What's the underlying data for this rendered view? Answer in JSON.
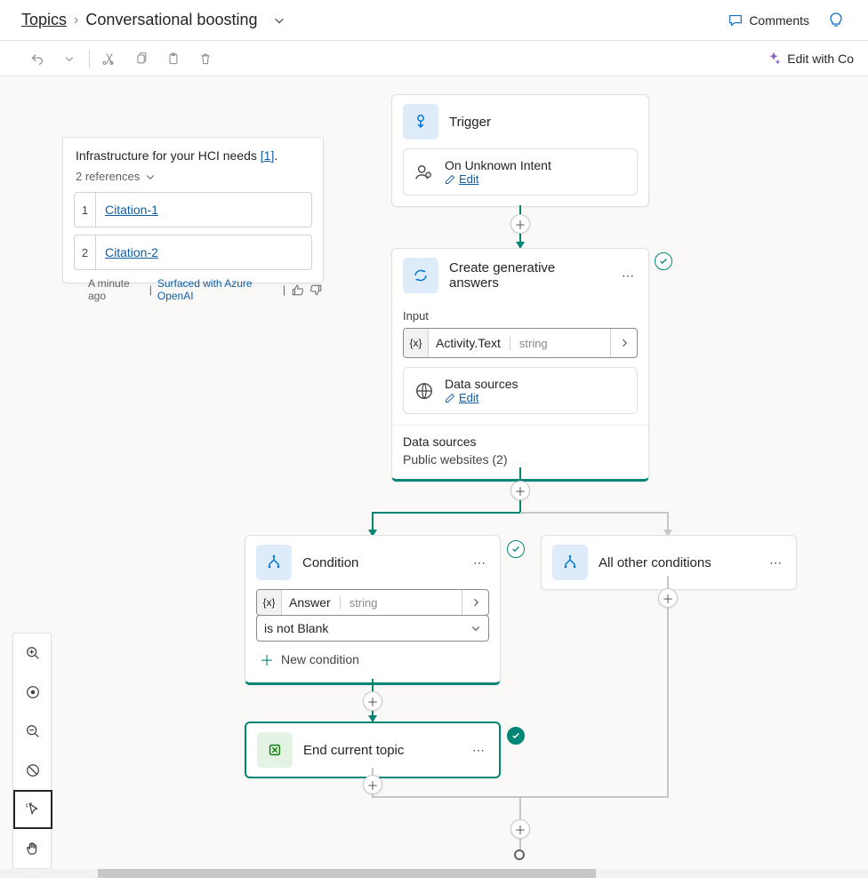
{
  "breadcrumb": {
    "root": "Topics",
    "current": "Conversational boosting"
  },
  "topActions": {
    "comments": "Comments",
    "editWithAI": "Edit with Co"
  },
  "msgCard": {
    "textFragment": "Infrastructure for your HCI needs ",
    "textLinkRef": "[1]",
    "textEnd": ".",
    "refsLabel": "2 references",
    "citations": [
      {
        "num": "1",
        "label": "Citation-1"
      },
      {
        "num": "2",
        "label": "Citation-2"
      }
    ],
    "time": "A minute ago",
    "surfaced": "Surfaced with Azure OpenAI"
  },
  "nodes": {
    "trigger": {
      "title": "Trigger",
      "sub": {
        "title": "On Unknown Intent",
        "edit": "Edit"
      }
    },
    "gen": {
      "title": "Create generative answers",
      "inputLabel": "Input",
      "input": {
        "name": "Activity.Text",
        "type": "string"
      },
      "ds": {
        "title": "Data sources",
        "edit": "Edit"
      },
      "dsFootLabel": "Data sources",
      "dsFootVal": "Public websites (2)"
    },
    "cond": {
      "title": "Condition",
      "var": {
        "name": "Answer",
        "type": "string"
      },
      "op": "is not Blank",
      "newCond": "New condition"
    },
    "other": {
      "title": "All other conditions"
    },
    "end": {
      "title": "End current topic"
    }
  }
}
